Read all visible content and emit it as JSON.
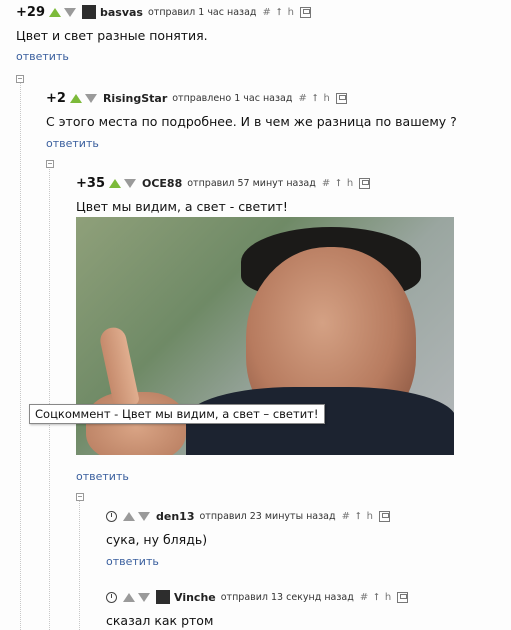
{
  "comments": [
    {
      "score": "+29",
      "author": "basvas",
      "time": "отправил 1 час назад",
      "text": "Цвет и свет разные понятия.",
      "reply": "ответить"
    },
    {
      "score": "+2",
      "author": "RisingStar",
      "time": "отправлено 1 час назад",
      "text": "С этого места по подробнее. И в чем же разница по вашему ?",
      "reply": "ответить"
    },
    {
      "score": "+35",
      "author": "OCE88",
      "time": "отправил 57 минут назад",
      "text": "Цвет мы видим, а свет - светит!",
      "reply": "ответить"
    },
    {
      "author": "den13",
      "time": "отправил 23 минуты назад",
      "text": "сука, ну блядь)",
      "reply": "ответить"
    },
    {
      "author": "Vinche",
      "time": "отправил 13 секунд назад",
      "text": "сказал как ртом"
    }
  ],
  "image_tooltip": "Соцкоммент - Цвет мы видим, а свет – светит!",
  "icons": {
    "hash": "#",
    "up": "⭡",
    "parent": "h"
  }
}
